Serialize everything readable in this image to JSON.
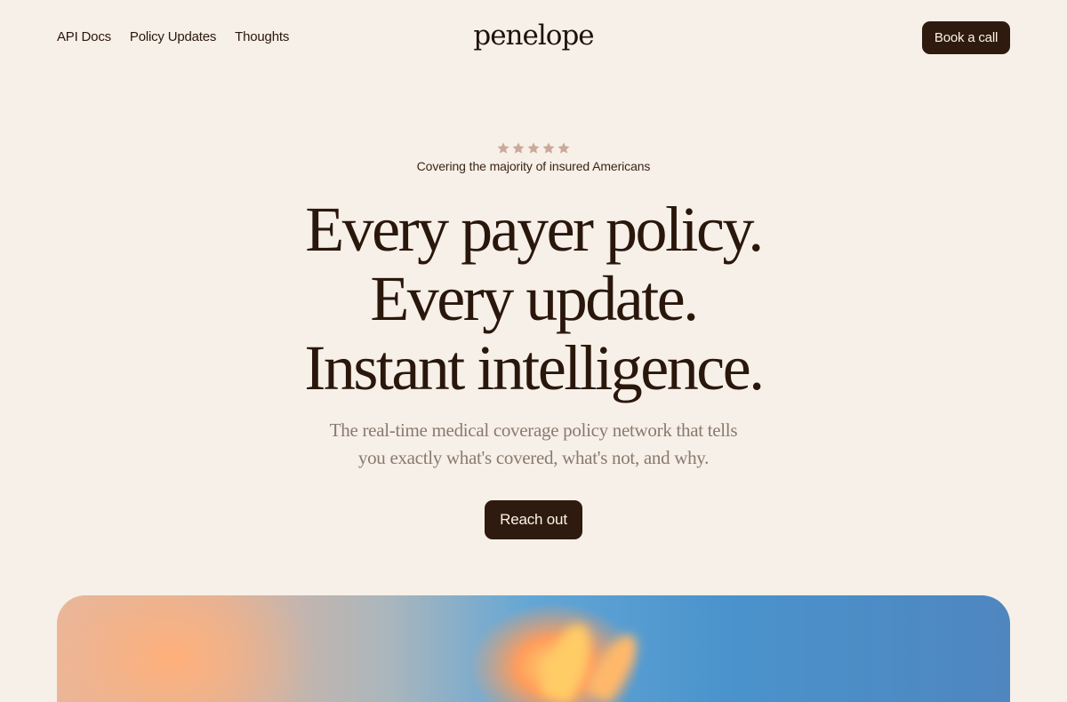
{
  "nav": {
    "links": [
      "API Docs",
      "Policy Updates",
      "Thoughts"
    ],
    "logo": "penelope",
    "cta_label": "Book a call"
  },
  "hero": {
    "rating": 5,
    "rating_text": "Covering the majority of insured Americans",
    "headline": [
      "Every payer policy.",
      "Every update.",
      "Instant intelligence."
    ],
    "subhead": "The real-time medical coverage policy network that tells you exactly what's covered, what's not, and why.",
    "cta_label": "Reach out"
  },
  "colors": {
    "background": "#f7f0e8",
    "button": "#2e1a0f",
    "star": "#c9a99a"
  },
  "icons": [
    "star-icon"
  ]
}
